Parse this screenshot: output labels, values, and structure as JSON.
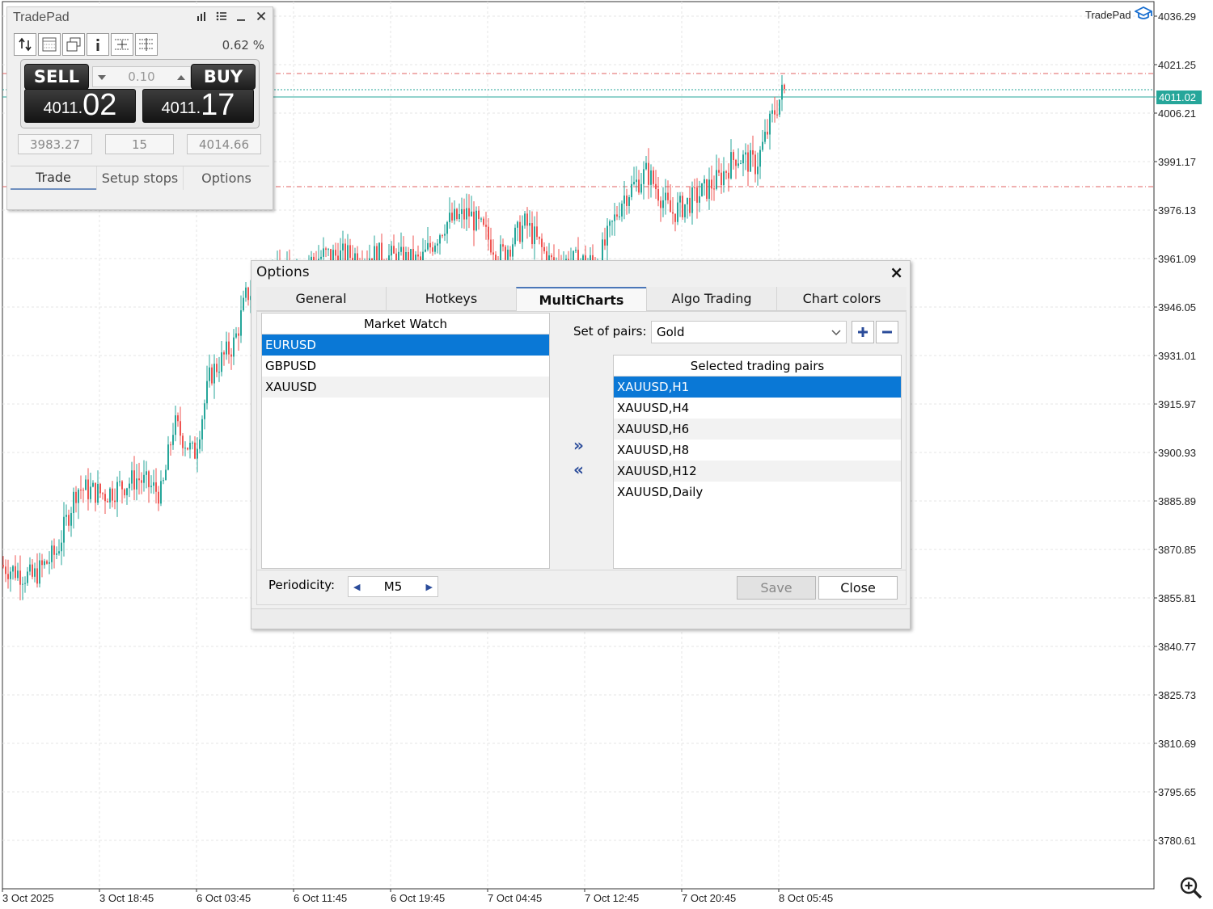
{
  "chart": {
    "brand": "TradePad",
    "current_price": "4011.02",
    "price_levels": [
      "4036.29",
      "4021.25",
      "4006.21",
      "3991.17",
      "3976.13",
      "3961.09",
      "3946.05",
      "3931.01",
      "3915.97",
      "3900.93",
      "3885.89",
      "3870.85",
      "3855.81",
      "3840.77",
      "3825.73",
      "3810.69",
      "3795.65",
      "3780.61"
    ],
    "time_labels": [
      "3 Oct 2025",
      "3 Oct 18:45",
      "6 Oct 03:45",
      "6 Oct 11:45",
      "6 Oct 19:45",
      "7 Oct 04:45",
      "7 Oct 12:45",
      "7 Oct 20:45",
      "8 Oct 05:45"
    ],
    "colors": {
      "bull": "#26a69a",
      "bear": "#ef5350",
      "grid": "#e6e6e6",
      "stop_line": "#e06060",
      "price_line": "#26a69a"
    }
  },
  "tradepad": {
    "title": "TradePad",
    "header_icons": [
      "bars-icon",
      "list-icon",
      "minimize-icon",
      "close-icon"
    ],
    "risk_percent": "0.62 %",
    "sell_label": "SELL",
    "buy_label": "BUY",
    "lot": "0.10",
    "sell_price_small": "4011.",
    "sell_price_large": "02",
    "buy_price_small": "4011.",
    "buy_price_large": "17",
    "stop_loss": "3983.27",
    "spread": "15",
    "take_profit": "4014.66",
    "tabs": [
      "Trade",
      "Setup stops",
      "Options"
    ]
  },
  "options": {
    "title": "Options",
    "tabs": [
      "General",
      "Hotkeys",
      "MultiCharts",
      "Algo Trading",
      "Chart colors"
    ],
    "active_tab": "MultiCharts",
    "market_watch": {
      "header": "Market Watch",
      "items": [
        "EURUSD",
        "GBPUSD",
        "XAUUSD"
      ]
    },
    "set_of_pairs_label": "Set of pairs:",
    "set_of_pairs_value": "Gold",
    "selected_pairs": {
      "header": "Selected trading pairs",
      "items": [
        "XAUUSD,H1",
        "XAUUSD,H4",
        "XAUUSD,H6",
        "XAUUSD,H8",
        "XAUUSD,H12",
        "XAUUSD,Daily"
      ]
    },
    "periodicity_label": "Periodicity:",
    "periodicity_value": "M5",
    "save_label": "Save",
    "close_label": "Close"
  }
}
